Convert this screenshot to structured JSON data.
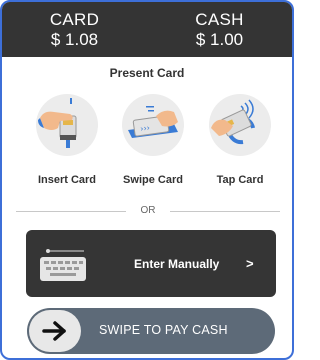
{
  "header": {
    "card": {
      "label": "CARD",
      "amount": "$ 1.08"
    },
    "cash": {
      "label": "CASH",
      "amount": "$ 1.00"
    }
  },
  "prompt": "Present Card",
  "methods": [
    {
      "label": "Insert Card",
      "icon": "insert-card-icon"
    },
    {
      "label": "Swipe Card",
      "icon": "swipe-card-icon"
    },
    {
      "label": "Tap Card",
      "icon": "tap-card-icon"
    }
  ],
  "divider_text": "OR",
  "manual": {
    "label": "Enter Manually",
    "chevron": ">",
    "icon": "keyboard-icon"
  },
  "swipe_to_pay": {
    "label": "SWIPE TO PAY CASH",
    "icon": "arrow-right-icon"
  },
  "colors": {
    "header_bg": "#343434",
    "frame_border": "#3d6fd8",
    "manual_bg": "#353535",
    "swipe_bg": "#5d6a78",
    "accent_blue": "#3a7bd5"
  }
}
